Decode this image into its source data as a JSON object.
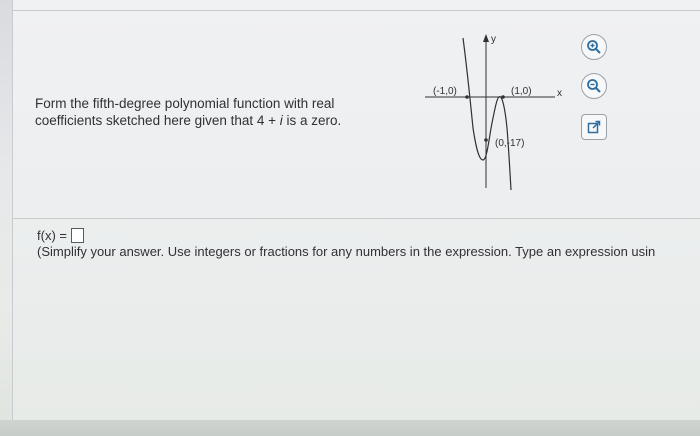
{
  "question": {
    "line1": "Form the fifth-degree polynomial function with real",
    "line2_pre": "coefficients sketched here given that 4 + ",
    "line2_i": "i",
    "line2_post": " is a zero."
  },
  "graph": {
    "axis_y_label": "y",
    "axis_x_label": "x",
    "point_left": "(-1,0)",
    "point_right": "(1,0)",
    "point_y_intercept": "(0,-17)"
  },
  "toolbar": {
    "zoom_in_icon": "zoom-in-icon",
    "zoom_out_icon": "zoom-out-icon",
    "popout_icon": "external-link-icon"
  },
  "answer": {
    "label": "f(x) ="
  },
  "instructions": {
    "text": "(Simplify your answer. Use integers or fractions for any numbers in the expression. Type an expression usin"
  },
  "colors": {
    "icon_color": "#2f6f9f",
    "text": "#2f3136"
  }
}
